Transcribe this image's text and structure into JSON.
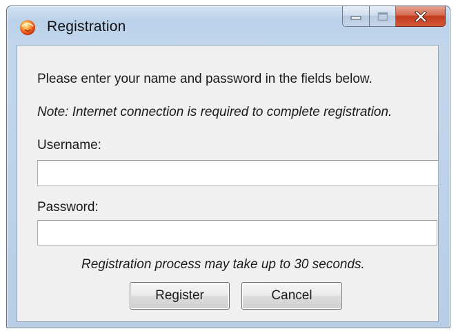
{
  "window": {
    "title": "Registration",
    "icon": "orange-app-icon"
  },
  "caption_buttons": {
    "minimize_icon": "minimize-icon",
    "maximize_icon": "maximize-icon",
    "close_icon": "close-icon"
  },
  "form": {
    "instruction": "Please enter your name and password in the fields below.",
    "note": "Note: Internet connection is required to complete registration.",
    "username_label": "Username:",
    "username_value": "",
    "password_label": "Password:",
    "password_value": "",
    "duration_note": "Registration process may take up to 30 seconds."
  },
  "buttons": {
    "register_label": "Register",
    "cancel_label": "Cancel"
  },
  "colors": {
    "close_button": "#c2391c",
    "frame": "#b9d1ea",
    "client_bg": "#f0f0f0"
  }
}
